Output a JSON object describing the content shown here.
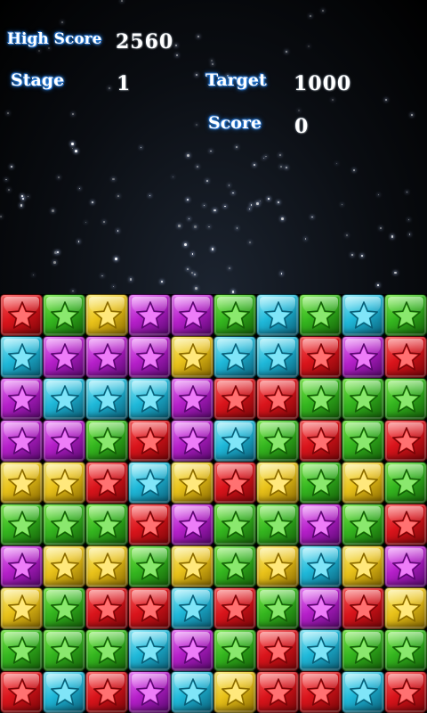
{
  "hud": {
    "high_score_label": "High Score",
    "high_score_value": "2560",
    "stage_label": "Stage",
    "stage_value": "1",
    "target_label": "Target",
    "target_value": "1000",
    "score_label": "Score",
    "score_value": "0"
  },
  "colors": {
    "R": {
      "base": "#d9141b",
      "light": "#ff5a5a",
      "dark": "#7a0508",
      "star": "#ff3b3b"
    },
    "G": {
      "base": "#34b51f",
      "light": "#7cf04a",
      "dark": "#145f08",
      "star": "#5ee036"
    },
    "Y": {
      "base": "#e9c21a",
      "light": "#fff07a",
      "dark": "#8a6a00",
      "star": "#ffe04a"
    },
    "P": {
      "base": "#b51fc9",
      "light": "#f07cff",
      "dark": "#5a0870",
      "star": "#e64cf5"
    },
    "C": {
      "base": "#1fb8d9",
      "light": "#8ef0ff",
      "dark": "#0a5f78",
      "star": "#4fdcf5"
    }
  },
  "board": {
    "rows": [
      [
        "R",
        "G",
        "Y",
        "P",
        "P",
        "G",
        "C",
        "G",
        "C",
        "G"
      ],
      [
        "C",
        "P",
        "P",
        "P",
        "Y",
        "C",
        "C",
        "R",
        "P",
        "R"
      ],
      [
        "P",
        "C",
        "C",
        "C",
        "P",
        "R",
        "R",
        "G",
        "G",
        "G"
      ],
      [
        "P",
        "P",
        "G",
        "R",
        "P",
        "C",
        "G",
        "R",
        "G",
        "R"
      ],
      [
        "Y",
        "Y",
        "R",
        "C",
        "Y",
        "R",
        "Y",
        "G",
        "Y",
        "G"
      ],
      [
        "G",
        "G",
        "G",
        "R",
        "P",
        "G",
        "G",
        "P",
        "G",
        "R"
      ],
      [
        "P",
        "Y",
        "Y",
        "G",
        "Y",
        "G",
        "Y",
        "C",
        "Y",
        "P"
      ],
      [
        "Y",
        "G",
        "R",
        "R",
        "C",
        "R",
        "G",
        "P",
        "R",
        "Y"
      ],
      [
        "G",
        "G",
        "G",
        "C",
        "P",
        "G",
        "R",
        "C",
        "G",
        "G"
      ],
      [
        "R",
        "C",
        "R",
        "P",
        "C",
        "Y",
        "R",
        "R",
        "C",
        "R"
      ]
    ]
  }
}
